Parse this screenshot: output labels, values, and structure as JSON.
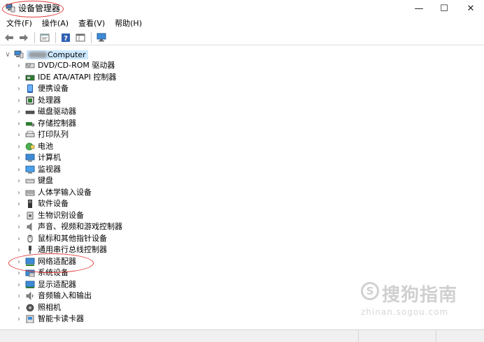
{
  "window": {
    "title": "设备管理器",
    "minimize_glyph": "—",
    "maximize_glyph": "☐",
    "close_glyph": "✕"
  },
  "menu": [
    "文件(F)",
    "操作(A)",
    "查看(V)",
    "帮助(H)"
  ],
  "toolbar": {
    "buttons": [
      "back-icon",
      "forward-icon",
      "properties-icon",
      "help-icon",
      "view-icon",
      "monitor-icon"
    ]
  },
  "tree": {
    "root": {
      "label_suffix": "Computer",
      "expanded": true
    },
    "items": [
      {
        "label": "DVD/CD-ROM 驱动器",
        "icon": "disc-drive-icon"
      },
      {
        "label": "IDE ATA/ATAPI 控制器",
        "icon": "ide-controller-icon"
      },
      {
        "label": "便携设备",
        "icon": "portable-device-icon"
      },
      {
        "label": "处理器",
        "icon": "processor-icon"
      },
      {
        "label": "磁盘驱动器",
        "icon": "disk-drive-icon"
      },
      {
        "label": "存储控制器",
        "icon": "storage-controller-icon"
      },
      {
        "label": "打印队列",
        "icon": "printer-icon"
      },
      {
        "label": "电池",
        "icon": "battery-icon"
      },
      {
        "label": "计算机",
        "icon": "computer-icon"
      },
      {
        "label": "监视器",
        "icon": "monitor-icon"
      },
      {
        "label": "键盘",
        "icon": "keyboard-icon"
      },
      {
        "label": "人体学输入设备",
        "icon": "hid-icon"
      },
      {
        "label": "软件设备",
        "icon": "software-device-icon"
      },
      {
        "label": "生物识别设备",
        "icon": "biometric-icon"
      },
      {
        "label": "声音、视频和游戏控制器",
        "icon": "speaker-icon"
      },
      {
        "label": "鼠标和其他指针设备",
        "icon": "mouse-icon"
      },
      {
        "label": "通用串行总线控制器",
        "icon": "usb-icon"
      },
      {
        "label": "网络适配器",
        "icon": "network-adapter-icon"
      },
      {
        "label": "系统设备",
        "icon": "system-device-icon"
      },
      {
        "label": "显示适配器",
        "icon": "display-adapter-icon"
      },
      {
        "label": "音频输入和输出",
        "icon": "audio-io-icon"
      },
      {
        "label": "照相机",
        "icon": "camera-icon"
      },
      {
        "label": "智能卡读卡器",
        "icon": "smartcard-reader-icon"
      }
    ]
  },
  "watermark": {
    "mark": "S",
    "brand": "搜狗指南",
    "url": "zhinan.sogou.com"
  },
  "colors": {
    "selection": "#cce8ff",
    "annotation": "#e23a3a"
  }
}
